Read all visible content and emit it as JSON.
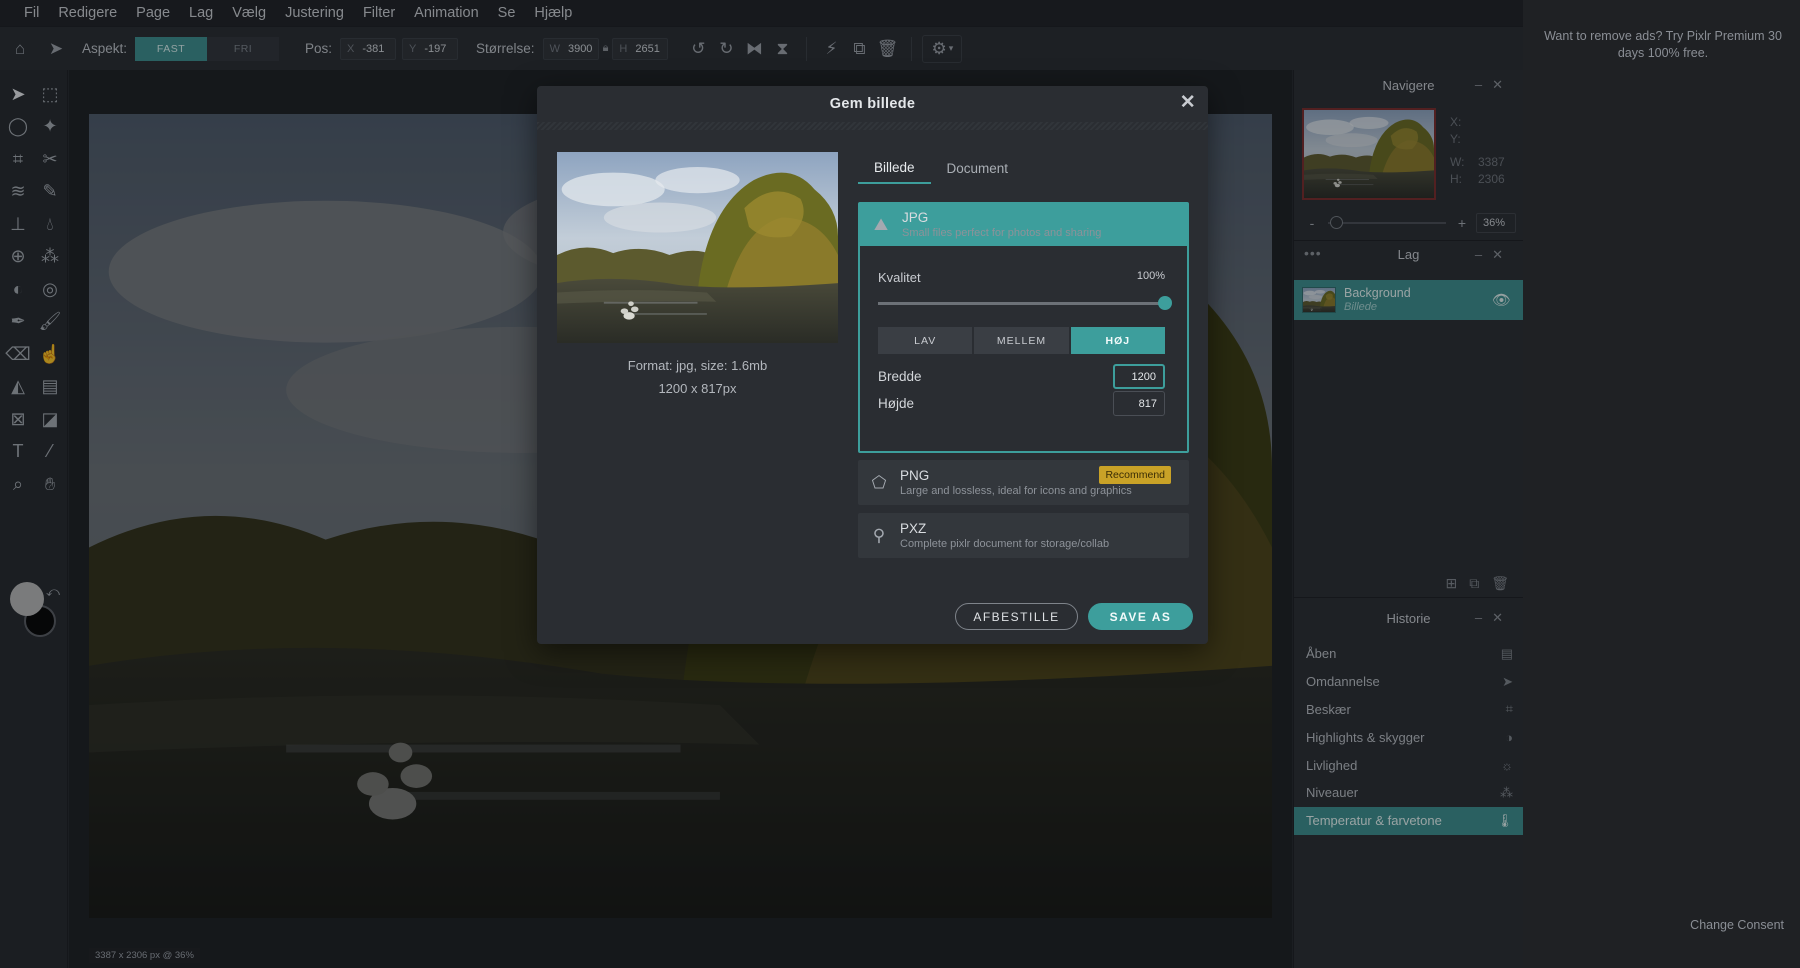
{
  "menu": [
    "Fil",
    "Redigere",
    "Page",
    "Lag",
    "Vælg",
    "Justering",
    "Filter",
    "Animation",
    "Se",
    "Hjælp"
  ],
  "toolbar": {
    "aspect_label": "Aspekt:",
    "aspect_fixed": "FAST",
    "aspect_free": "FRI",
    "pos_label": "Pos:",
    "pos_x_label": "X",
    "pos_x": "-381",
    "pos_y_label": "Y",
    "pos_y": "-197",
    "size_label": "Størrelse:",
    "size_w_label": "W",
    "size_w": "3900",
    "size_h_label": "H",
    "size_h": "2651"
  },
  "tools": [
    "arrow-icon",
    "marquee-icon",
    "lasso-icon",
    "magic-wand-icon",
    "crop-icon",
    "cut-icon",
    "liquify-icon",
    "heal-icon",
    "stamp-icon",
    "drop-icon",
    "sphere-icon",
    "spots-icon",
    "dodge-icon",
    "sponge-icon",
    "pen-icon",
    "brush-icon",
    "eraser-icon",
    "smudge-icon",
    "fill-icon",
    "gradient-icon",
    "frame-icon",
    "shape-icon",
    "text-icon",
    "eyedropper-icon",
    "zoom-icon",
    "hand-icon"
  ],
  "canvas": {
    "status": "3387 x 2306 px @ 36%"
  },
  "navigator": {
    "title": "Navigere",
    "x_label": "X:",
    "y_label": "Y:",
    "w_label": "W:",
    "w": "3387",
    "h_label": "H:",
    "h": "2306",
    "zoom": "36%",
    "zoom_fraction": 0.07
  },
  "layers": {
    "title": "Lag",
    "name": "Background",
    "subtitle": "Billede"
  },
  "history": {
    "title": "Historie",
    "items": [
      {
        "label": "Åben",
        "icon": "document-icon"
      },
      {
        "label": "Omdannelse",
        "icon": "arrow-icon"
      },
      {
        "label": "Beskær",
        "icon": "crop-icon"
      },
      {
        "label": "Highlights & skygger",
        "icon": "contrast-icon"
      },
      {
        "label": "Livlighed",
        "icon": "sun-icon"
      },
      {
        "label": "Niveauer",
        "icon": "circles-icon"
      },
      {
        "label": "Temperatur & farvetone",
        "icon": "thermometer-icon"
      }
    ],
    "active_index": 6
  },
  "dialog": {
    "title": "Gem billede",
    "preview_format": "Format: jpg, size: 1.6mb",
    "preview_dims": "1200 x 817px",
    "tab_image": "Billede",
    "tab_document": "Document",
    "jpg_title": "JPG",
    "jpg_sub": "Small files perfect for photos and sharing",
    "quality_label": "Kvalitet",
    "quality_value": "100%",
    "quality_fraction": 1.0,
    "q_low": "LAV",
    "q_mid": "MELLEM",
    "q_high": "HØJ",
    "width_label": "Bredde",
    "width_value": "1200",
    "height_label": "Højde",
    "height_value": "817",
    "png_title": "PNG",
    "png_sub": "Large and lossless, ideal for icons and graphics",
    "recommend": "Recommend",
    "pxz_title": "PXZ",
    "pxz_sub": "Complete pixlr document for storage/collab",
    "cancel": "AFBESTILLE",
    "save": "SAVE AS"
  },
  "ad": {
    "text": "Want to remove ads? Try Pixlr Premium 30 days 100% free.",
    "consent": "Change Consent"
  },
  "colors": {
    "accent": "#3d9e9c",
    "recommend": "#c9a227",
    "foreground": "#b7b7b7",
    "background": "#050505"
  }
}
